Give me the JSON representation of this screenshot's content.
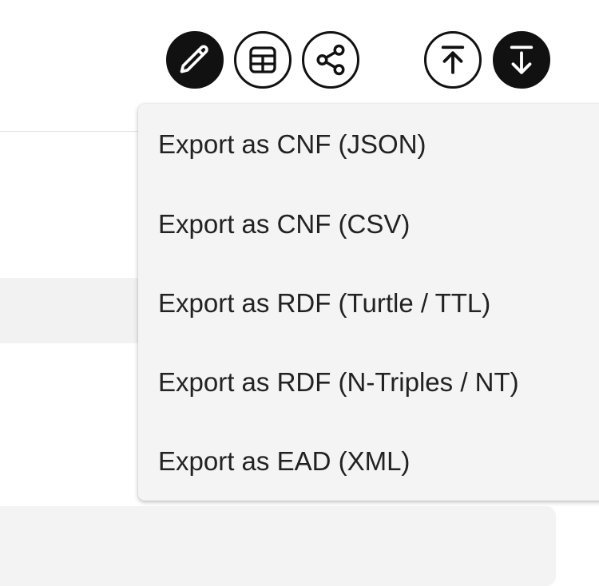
{
  "toolbar": {
    "buttons": [
      {
        "icon": "pencil-icon",
        "style": "filled"
      },
      {
        "icon": "table-icon",
        "style": "outline"
      },
      {
        "icon": "share-icon",
        "style": "outline"
      },
      {
        "icon": "upload-icon",
        "style": "outline"
      },
      {
        "icon": "download-icon",
        "style": "filled"
      }
    ]
  },
  "export_menu": {
    "items": [
      "Export as CNF (JSON)",
      "Export as CNF (CSV)",
      "Export as RDF (Turtle / TTL)",
      "Export as RDF (N-Triples / NT)",
      "Export as EAD (XML)"
    ]
  },
  "colors": {
    "icon_dark": "#111111",
    "menu_bg": "#f4f4f4",
    "menu_text": "#222222",
    "panel_bg": "#f2f2f2"
  }
}
